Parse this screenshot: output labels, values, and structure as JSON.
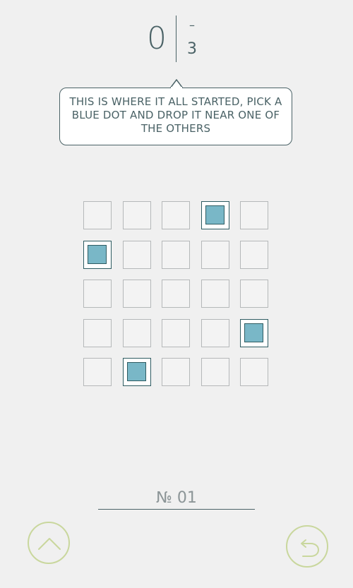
{
  "score": {
    "moves": "0",
    "target_dash": "–",
    "target": "3"
  },
  "tooltip": {
    "text": "This is where it all started, pick a blue dot and drop it near one of the others"
  },
  "board": {
    "rows": 5,
    "cols": 5,
    "dots": [
      [
        0,
        3
      ],
      [
        1,
        0
      ],
      [
        3,
        4
      ],
      [
        4,
        1
      ]
    ]
  },
  "level": {
    "label": "№ 01"
  },
  "buttons": {
    "up_icon": "chevron-up-icon",
    "undo_icon": "undo-icon"
  },
  "colors": {
    "ink": "#4a6266",
    "dot_fill": "#79b7c7",
    "dot_border": "#2f5c62",
    "cell_border": "#b5b8b9",
    "button_ring": "#c9d79d"
  }
}
